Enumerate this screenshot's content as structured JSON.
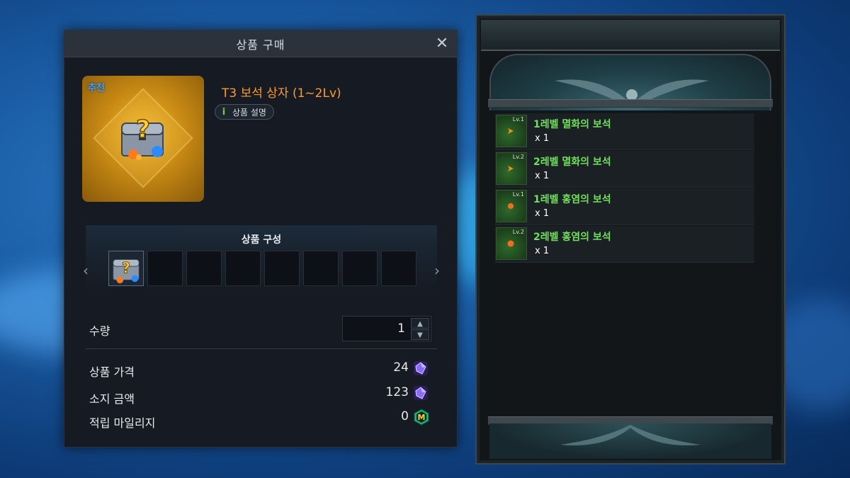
{
  "dialog": {
    "title": "상품 구매",
    "badge": "추천",
    "product_name": "T3 보석 상자 (1~2Lv)",
    "info_icon": "i",
    "description_label": "상품 설명",
    "composition_title": "상품 구성",
    "quantity_label": "수량",
    "quantity_value": "1",
    "price_label": "상품 가격",
    "price_value": "24",
    "balance_label": "소지 금액",
    "balance_value": "123",
    "mileage_label": "적립 마일리지",
    "mileage_value": "0",
    "mileage_icon_letter": "M",
    "close_glyph": "✕",
    "prev_glyph": "‹",
    "next_glyph": "›",
    "up_glyph": "▲",
    "down_glyph": "▼"
  },
  "rewards": [
    {
      "level": "Lv.1",
      "name": "1레벨 멸화의 보석",
      "qty": "x 1",
      "gem": "멸화"
    },
    {
      "level": "Lv.2",
      "name": "2레벨 멸화의 보석",
      "qty": "x 1",
      "gem": "멸화"
    },
    {
      "level": "Lv.1",
      "name": "1레벨 홍염의 보석",
      "qty": "x 1",
      "gem": "홍염"
    },
    {
      "level": "Lv.2",
      "name": "2레벨 홍염의 보석",
      "qty": "x 1",
      "gem": "홍염"
    }
  ],
  "colors": {
    "product_name": "#ff9a2a",
    "reward_name": "#6fe05a",
    "badge": "#3aa0ff"
  }
}
